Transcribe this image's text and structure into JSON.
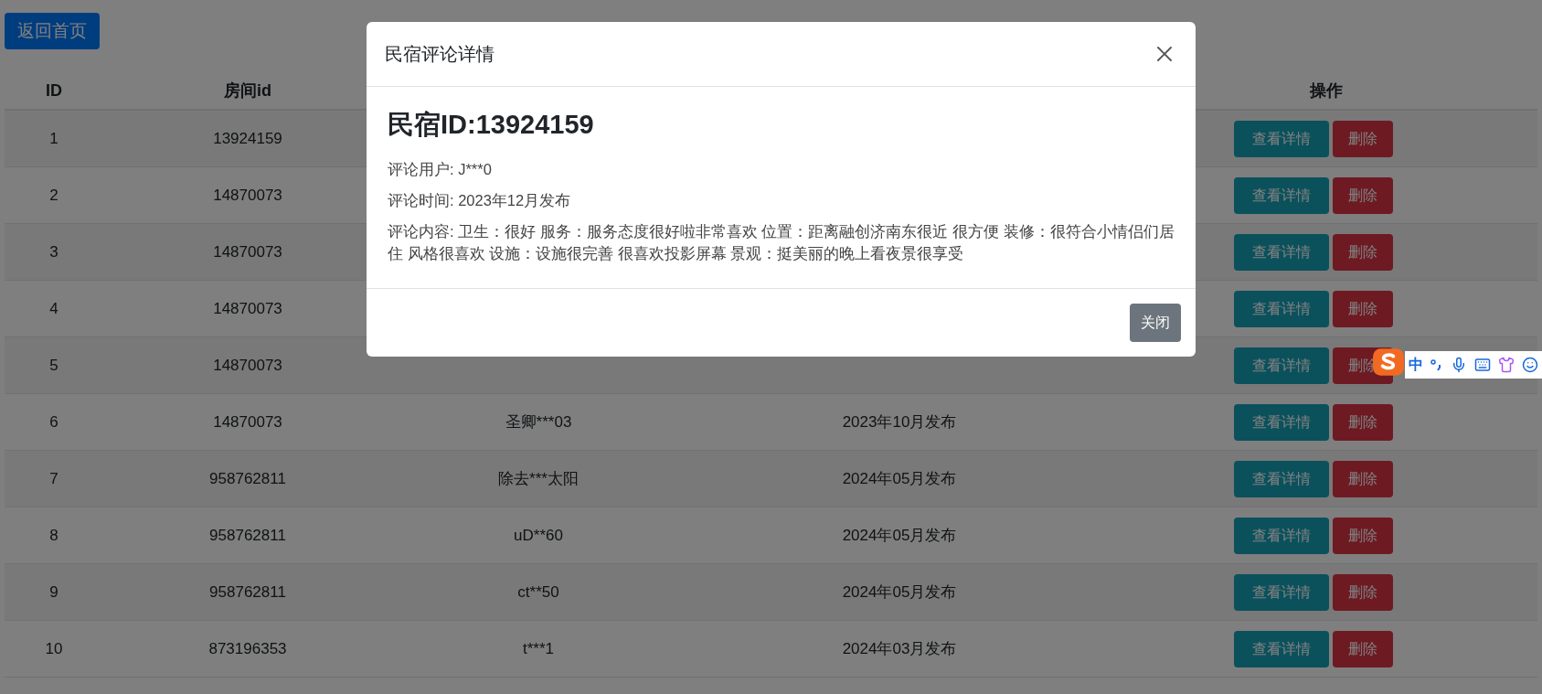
{
  "back_button": "返回首页",
  "table": {
    "header": {
      "id": "ID",
      "room_id": "房间id",
      "actions": "操作"
    },
    "rows": [
      {
        "id": "1",
        "room_id": "13924159",
        "actions": [
          "查看详情",
          "删除"
        ]
      },
      {
        "id": "2",
        "room_id": "14870073",
        "actions": [
          "查看详情",
          "删除"
        ]
      },
      {
        "id": "3",
        "room_id": "14870073",
        "actions": [
          "查看详情",
          "删除"
        ]
      },
      {
        "id": "4",
        "room_id": "14870073",
        "actions": [
          "查看详情",
          "删除"
        ]
      },
      {
        "id": "5",
        "room_id": "14870073",
        "actions": [
          "查看详情",
          "删除"
        ]
      },
      {
        "id": "6",
        "room_id": "14870073",
        "user": "圣卿***03",
        "time": "2023年10月发布",
        "actions": [
          "查看详情",
          "删除"
        ]
      },
      {
        "id": "7",
        "room_id": "958762811",
        "user": "除去***太阳",
        "time": "2024年05月发布",
        "actions": [
          "查看详情",
          "删除"
        ]
      },
      {
        "id": "8",
        "room_id": "958762811",
        "user": "uD**60",
        "time": "2024年05月发布",
        "actions": [
          "查看详情",
          "删除"
        ]
      },
      {
        "id": "9",
        "room_id": "958762811",
        "user": "ct**50",
        "time": "2024年05月发布",
        "actions": [
          "查看详情",
          "删除"
        ]
      },
      {
        "id": "10",
        "room_id": "873196353",
        "user": "t***1",
        "time": "2024年03月发布",
        "actions": [
          "查看详情",
          "删除"
        ]
      }
    ]
  },
  "modal": {
    "title": "民宿评论详情",
    "heading": "民宿ID:13924159",
    "lines": [
      "评论用户: J***0",
      "评论时间: 2023年12月发布",
      "评论内容: 卫生：很好 服务：服务态度很好啦非常喜欢 位置：距离融创济南东很近 很方便 装修：很符合小情侣们居住 风格很喜欢 设施：设施很完善 很喜欢投影屏幕 景观：挺美丽的晚上看夜景很享受"
    ],
    "close_button": "关闭"
  },
  "ime_toolbar": {
    "mode": "中"
  }
}
